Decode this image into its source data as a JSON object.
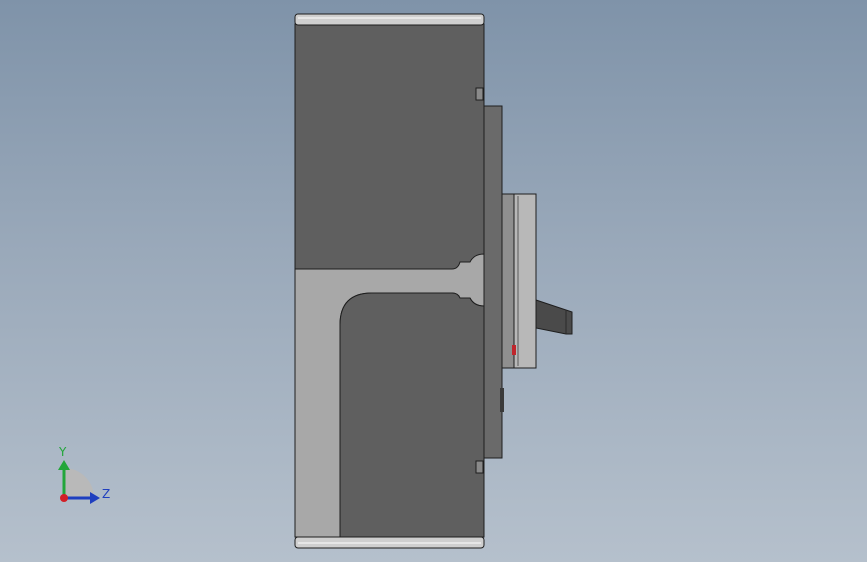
{
  "viewport": {
    "colors": {
      "background_top": "#7f93a9",
      "background_bottom": "#b5c0cc",
      "body_dark": "#5f5f5f",
      "body_light": "#a8a8a8",
      "edge": "#1e1e1e",
      "cap": "#cfcfcf",
      "plate": "#6a6a6a",
      "handle": "#4a4a4a",
      "accent_red": "#c0262c"
    }
  },
  "triad": {
    "y_label": "Y",
    "z_label": "Z",
    "colors": {
      "y": "#22a63a",
      "z": "#1f3fbf",
      "origin": "#d21f26",
      "quadrant": "#b9b9b9"
    }
  }
}
